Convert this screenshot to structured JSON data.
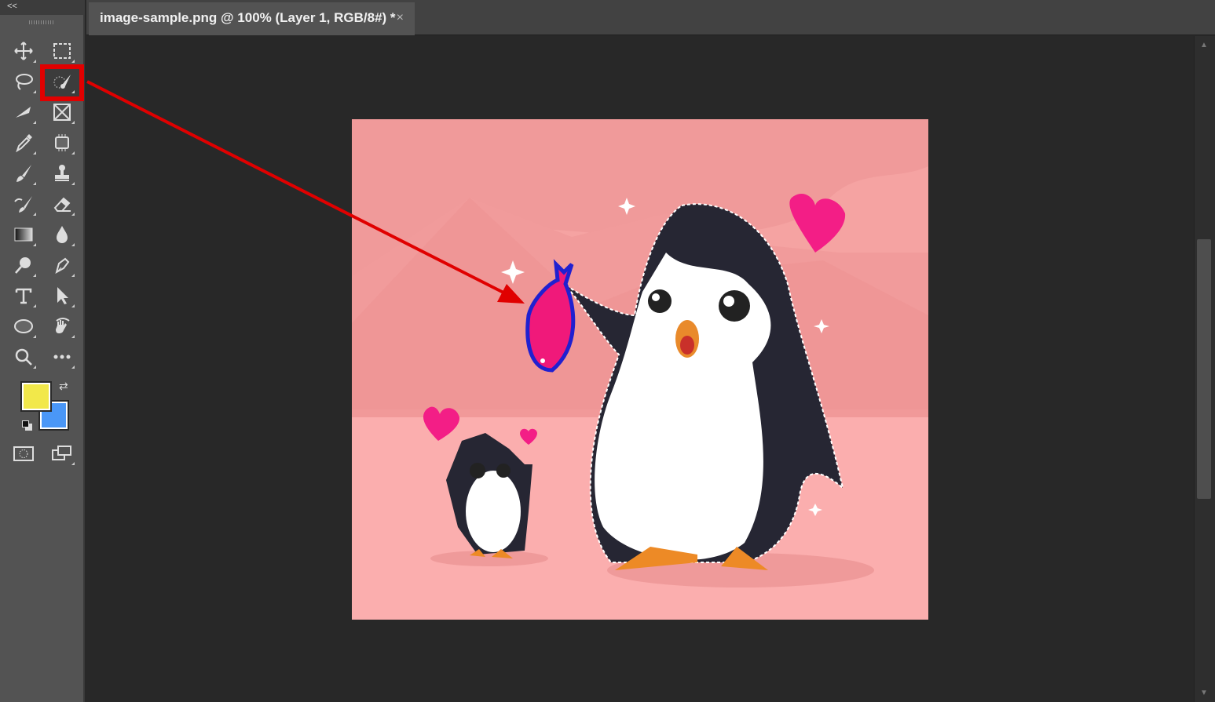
{
  "toolbar": {
    "collapse_label": "<<",
    "tools": [
      {
        "name": "move-tool"
      },
      {
        "name": "rectangular-marquee-tool"
      },
      {
        "name": "lasso-tool"
      },
      {
        "name": "object-selection-tool"
      },
      {
        "name": "crop-tool"
      },
      {
        "name": "frame-tool"
      },
      {
        "name": "eyedropper-tool"
      },
      {
        "name": "spot-healing-tool"
      },
      {
        "name": "brush-tool"
      },
      {
        "name": "clone-stamp-tool"
      },
      {
        "name": "history-brush-tool"
      },
      {
        "name": "eraser-tool"
      },
      {
        "name": "gradient-tool"
      },
      {
        "name": "blur-tool"
      },
      {
        "name": "dodge-tool"
      },
      {
        "name": "pen-tool"
      },
      {
        "name": "type-tool"
      },
      {
        "name": "path-selection-tool"
      },
      {
        "name": "ellipse-tool"
      },
      {
        "name": "rotate-view-tool"
      },
      {
        "name": "zoom-tool"
      },
      {
        "name": "more-tools"
      }
    ],
    "foreground_color": "#f2e84a",
    "background_color": "#4a97f7",
    "highlighted_tool": "object-selection-tool",
    "highlight_color": "#e00000"
  },
  "document": {
    "tab_title": "image-sample.png @ 100% (Layer 1, RGB/8#) *",
    "close_label": "×"
  }
}
